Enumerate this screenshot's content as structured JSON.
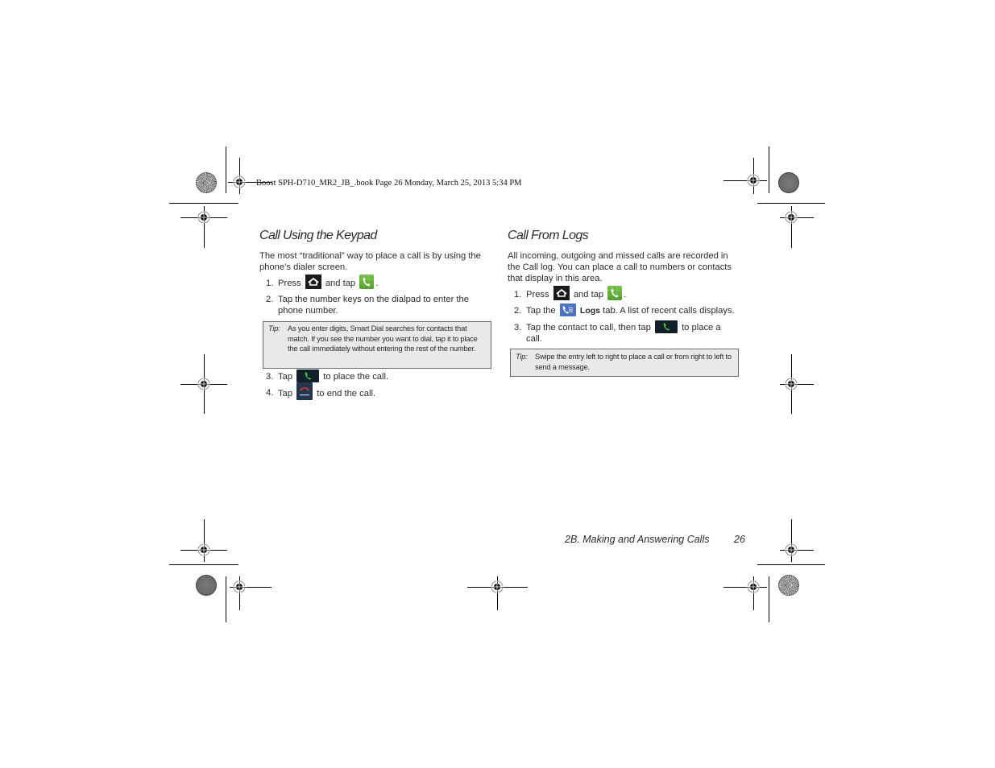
{
  "slug_line": "Boost SPH-D710_MR2_JB_.book  Page 26  Monday, March 25, 2013  5:34 PM",
  "left_section": {
    "title": "Call Using the Keypad",
    "intro": "The most “traditional” way to place a call is by using the phone’s dialer screen.",
    "steps": [
      {
        "num": "1.",
        "pre": "Press",
        "icon1": "home-key-icon",
        "mid": "and tap",
        "icon2": "phone-app-icon",
        "post": "."
      },
      {
        "num": "2.",
        "text": "Tap the number keys on the dialpad to enter the phone number."
      },
      {
        "num": "3.",
        "pre": "Tap",
        "icon1": "call-button-icon",
        "post": "to place the call."
      },
      {
        "num": "4.",
        "pre": "Tap",
        "icon1": "end-call-button-icon",
        "icon1_label": "End call",
        "post": "to end the call."
      }
    ],
    "tip": {
      "label": "Tip:",
      "text": "As you enter digits, Smart Dial searches for contacts that match. If you see the number you want to dial, tap it to place the call immediately without entering the rest of the number."
    }
  },
  "right_section": {
    "title": "Call From Logs",
    "intro": "All incoming, outgoing and missed calls are recorded in the Call log. You can place a call to numbers or contacts that display in this area.",
    "steps": [
      {
        "num": "1.",
        "pre": "Press",
        "icon1": "home-key-icon",
        "mid": "and tap",
        "icon2": "phone-app-icon",
        "post": "."
      },
      {
        "num": "2.",
        "pre": "Tap the",
        "icon1": "logs-tab-icon",
        "bold": "Logs",
        "post": "tab. A list of recent calls displays."
      },
      {
        "num": "3.",
        "text": "Tap the contact to call, then tap",
        "icon1": "call-button-icon",
        "post": "to place a call."
      }
    ],
    "tip": {
      "label": "Tip:",
      "text": "Swipe the entry left to right to place a call or from right to left to send a message."
    }
  },
  "footer": {
    "chapter": "2B. Making and Answering Calls",
    "page": "26"
  },
  "colors": {
    "tip_background": "#e9e9e9",
    "phone_icon_green": "#5fae35",
    "logs_tab_blue": "#4a72c4",
    "end_call_red": "#d2322d"
  }
}
